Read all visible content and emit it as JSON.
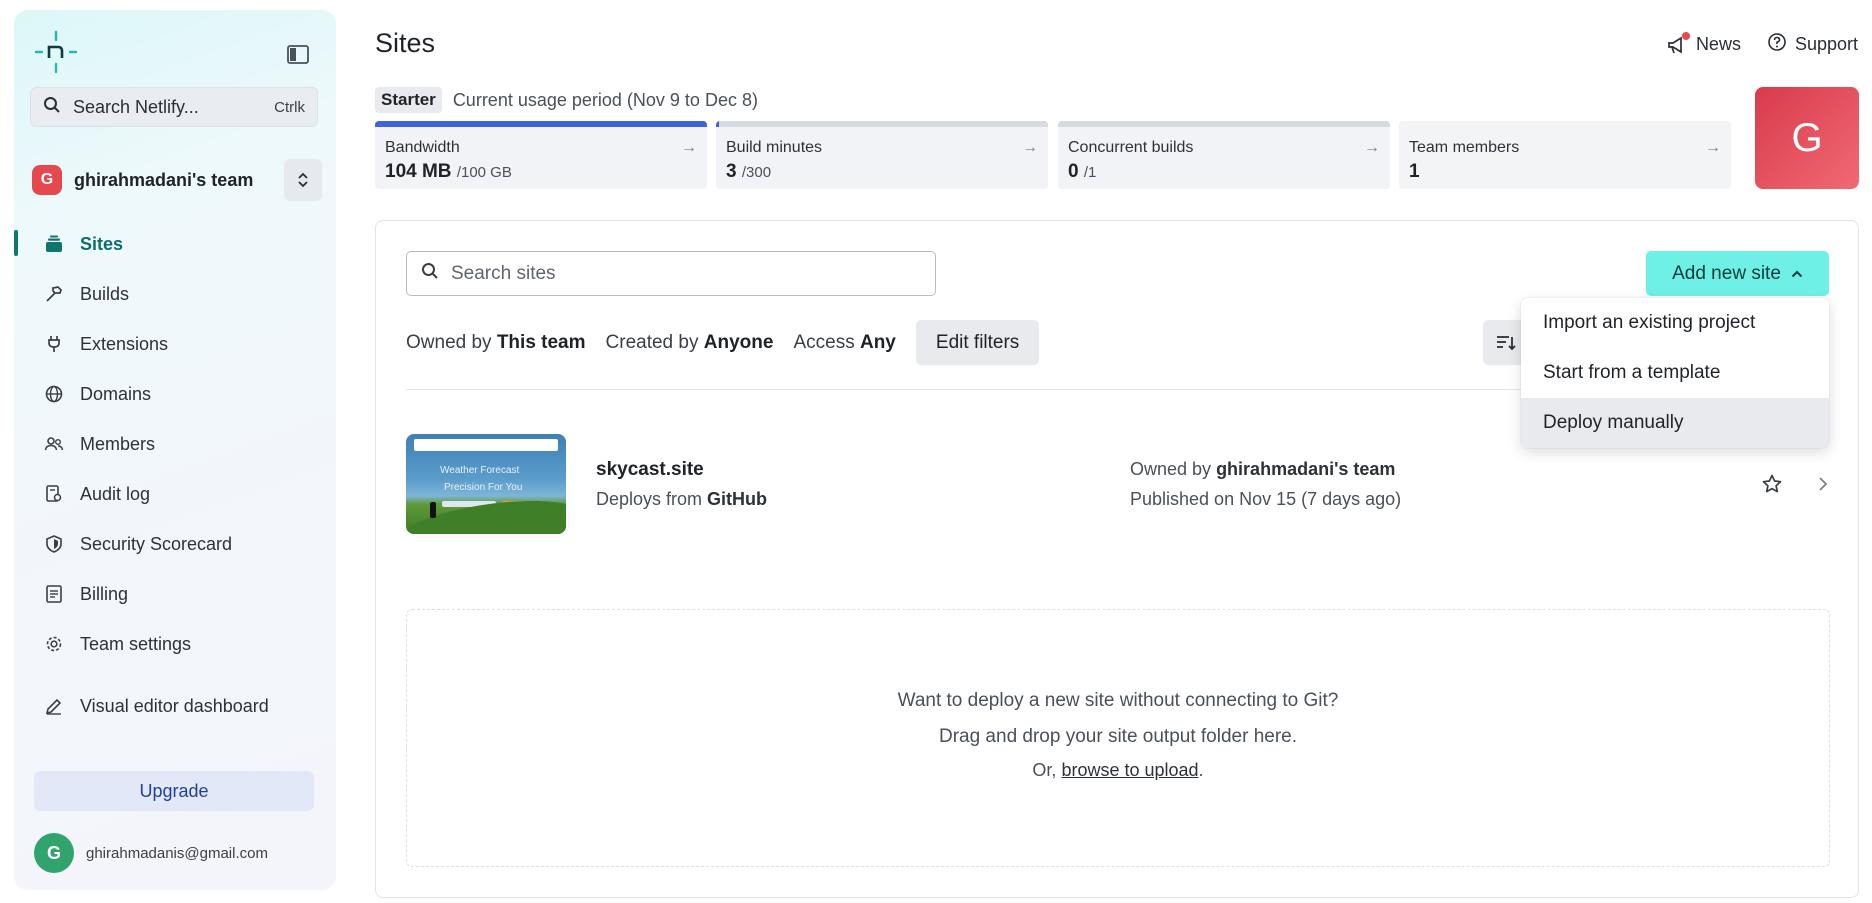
{
  "sidebar": {
    "search_label": "Search Netlify...",
    "search_shortcut": "Ctrlk",
    "team_initial": "G",
    "team_name": "ghirahmadani's team",
    "items": [
      {
        "label": "Sites",
        "icon": "stack-icon",
        "active": true
      },
      {
        "label": "Builds",
        "icon": "hammer-icon"
      },
      {
        "label": "Extensions",
        "icon": "plug-icon"
      },
      {
        "label": "Domains",
        "icon": "globe-icon"
      },
      {
        "label": "Members",
        "icon": "users-icon"
      },
      {
        "label": "Audit log",
        "icon": "audit-log-icon"
      },
      {
        "label": "Security Scorecard",
        "icon": "shield-icon"
      },
      {
        "label": "Billing",
        "icon": "receipt-icon"
      },
      {
        "label": "Team settings",
        "icon": "gear-icon"
      },
      {
        "label": "Visual editor dashboard",
        "icon": "pencil-icon"
      }
    ],
    "upgrade_label": "Upgrade",
    "user_initial": "G",
    "user_email": "ghirahmadanis@gmail.com"
  },
  "header": {
    "title": "Sites",
    "news_label": "News",
    "support_label": "Support",
    "plan_badge": "Starter",
    "usage_period": "Current usage period (Nov 9 to Dec 8)",
    "avatar_initial": "G"
  },
  "usage": [
    {
      "label": "Bandwidth",
      "value": "104 MB",
      "limit": "/100 GB",
      "fill_percent": 100
    },
    {
      "label": "Build minutes",
      "value": "3",
      "limit": "/300",
      "fill_percent": 1
    },
    {
      "label": "Concurrent builds",
      "value": "0",
      "limit": "/1",
      "fill_percent": 0
    },
    {
      "label": "Team members",
      "value": "1",
      "limit": "",
      "fill_percent": 0
    }
  ],
  "main": {
    "search_placeholder": "Search sites",
    "add_site_label": "Add new site",
    "filters": {
      "owned_prefix": "Owned by",
      "owned_value": "This team",
      "created_prefix": "Created by",
      "created_value": "Anyone",
      "access_prefix": "Access",
      "access_value": "Any",
      "edit_label": "Edit filters"
    },
    "site": {
      "name": "skycast.site",
      "deploys_prefix": "Deploys from",
      "deploys_source": "GitHub",
      "owned_prefix": "Owned by",
      "owner": "ghirahmadani's team",
      "published": "Published on Nov 15 (7 days ago)",
      "thumb_line1": "Weather   Forecast",
      "thumb_line2": "Precision   For You"
    },
    "dropzone": {
      "line1": "Want to deploy a new site without connecting to Git?",
      "line2": "Drag and drop your site output folder here.",
      "line3_prefix": "Or,",
      "line3_link": "browse to upload",
      "line3_suffix": "."
    }
  },
  "dropdown": {
    "items": [
      "Import an existing project",
      "Start from a template",
      "Deploy manually"
    ],
    "highlighted": "Deploy manually"
  },
  "colors": {
    "accent": "#0f766e",
    "add_button": "#6ff0e6",
    "team_avatar": "#e5484d",
    "user_avatar": "#30a46c",
    "usage_bar": "#3e63dd"
  }
}
